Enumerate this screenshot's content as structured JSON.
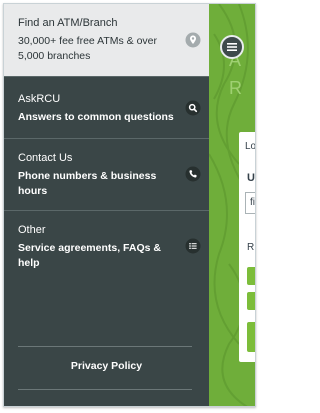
{
  "menu": {
    "items": [
      {
        "title": "Find an ATM/Branch",
        "description": "30,000+ fee free ATMs & over 5,000 branches",
        "icon": "location-pin-icon"
      },
      {
        "title": "AskRCU",
        "description": "Answers to common questions",
        "icon": "search-icon"
      },
      {
        "title": "Contact Us",
        "description": "Phone numbers & business hours",
        "icon": "phone-icon"
      },
      {
        "title": "Other",
        "description": "Service agreements, FAQs & help",
        "icon": "list-icon"
      }
    ],
    "footer_link": "Privacy Policy"
  },
  "background": {
    "heading_fragment_1": "A",
    "heading_fragment_2": "R",
    "label_1": "Lo",
    "label_2": "U",
    "label_3": "R",
    "field_fragment": "fi"
  },
  "colors": {
    "drawer_bg": "#3a4647",
    "top_item_bg": "#e9eaeb",
    "brand_green": "#6fae3a",
    "text_light": "#ffffff",
    "text_dark": "#2c3538"
  }
}
